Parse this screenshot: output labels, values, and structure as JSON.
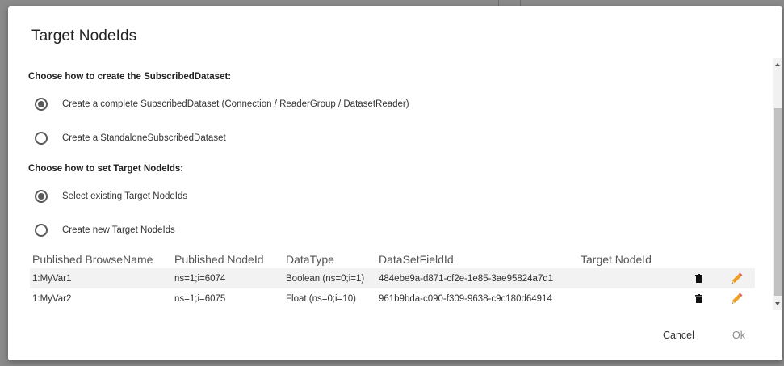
{
  "dialog": {
    "title": "Target NodeIds",
    "section1": {
      "label": "Choose how to create the SubscribedDataset:",
      "options": [
        {
          "label": "Create a complete SubscribedDataset (Connection / ReaderGroup / DatasetReader)",
          "selected": true
        },
        {
          "label": "Create a StandaloneSubscribedDataset",
          "selected": false
        }
      ]
    },
    "section2": {
      "label": "Choose how to set Target NodeIds:",
      "options": [
        {
          "label": "Select existing Target NodeIds",
          "selected": true
        },
        {
          "label": "Create new Target NodeIds",
          "selected": false
        }
      ]
    },
    "table": {
      "headers": [
        "Published BrowseName",
        "Published NodeId",
        "DataType",
        "DataSetFieldId",
        "Target NodeId"
      ],
      "rows": [
        {
          "browse_name": "1:MyVar1",
          "node_id": "ns=1;i=6074",
          "data_type": "Boolean (ns=0;i=1)",
          "field_id": "484ebe9a-d871-cf2e-1e85-3ae95824a7d1",
          "target": ""
        },
        {
          "browse_name": "1:MyVar2",
          "node_id": "ns=1;i=6075",
          "data_type": "Float (ns=0;i=10)",
          "field_id": "961b9bda-c090-f309-9638-c9c180d64914",
          "target": ""
        }
      ],
      "icons": {
        "delete": "trash-icon",
        "edit": "pencil-icon"
      }
    },
    "buttons": {
      "cancel": "Cancel",
      "ok": "Ok"
    },
    "colors": {
      "accent": "#f0a020",
      "radio": "#5a5a5a",
      "ok_disabled": "#8a8a8a"
    }
  }
}
